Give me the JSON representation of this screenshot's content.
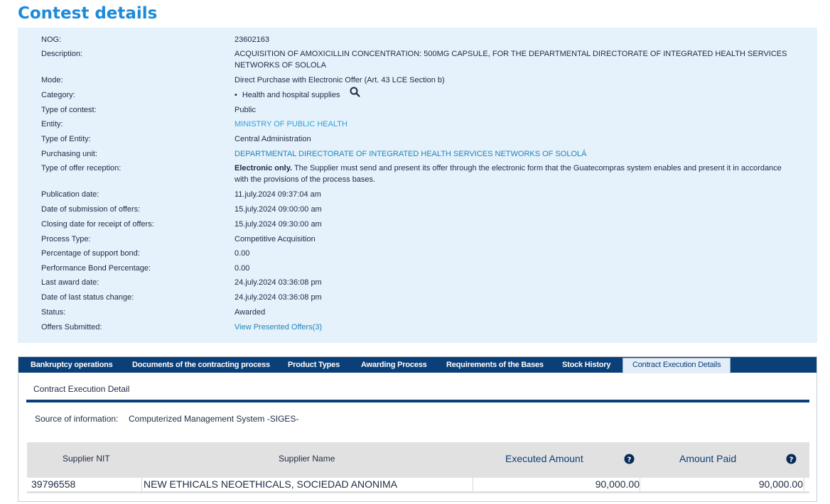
{
  "page": {
    "title": "Contest details"
  },
  "details": {
    "nog": {
      "label": "NOG:",
      "value": "23602163"
    },
    "description": {
      "label": "Description:",
      "value": "ACQUISITION OF AMOXICILLIN CONCENTRATION: 500MG CAPSULE, FOR THE DEPARTMENTAL DIRECTORATE OF INTEGRATED HEALTH SERVICES NETWORKS OF SOLOLA"
    },
    "mode": {
      "label": "Mode:",
      "value": "Direct Purchase with Electronic Offer (Art. 43 LCE Section b)"
    },
    "category": {
      "label": "Category:",
      "bullet": "•",
      "value": "Health and hospital supplies",
      "icon": "search-icon"
    },
    "type_of_contest": {
      "label": "Type of contest:",
      "value": "Public"
    },
    "entity": {
      "label": "Entity:",
      "value": "MINISTRY OF PUBLIC HEALTH"
    },
    "type_of_entity": {
      "label": "Type of Entity:",
      "value": "Central Administration"
    },
    "purchasing_unit": {
      "label": "Purchasing unit:",
      "value": "DEPARTMENTAL DIRECTORATE OF INTEGRATED HEALTH SERVICES NETWORKS OF SOLOLÁ"
    },
    "offer_reception": {
      "label": "Type of offer reception:",
      "value_bold": "Electronic only.",
      "value": " The Supplier must send and present its offer through the electronic form that the Guatecompras system enables and present it in accordance with the provisions of the process bases."
    },
    "publication_date": {
      "label": "Publication date:",
      "value": "11.july.2024 09:37:04 am"
    },
    "submission_date": {
      "label": "Date of submission of offers:",
      "value": "15.july.2024 09:00:00 am"
    },
    "closing_date": {
      "label": "Closing date for receipt of offers:",
      "value": "15.july.2024 09:30:00 am"
    },
    "process_type": {
      "label": "Process Type:",
      "value": "Competitive Acquisition"
    },
    "support_bond": {
      "label": "Percentage of support bond:",
      "value": "0.00"
    },
    "performance_bond": {
      "label": "Performance Bond Percentage:",
      "value": "0.00"
    },
    "last_award_date": {
      "label": "Last award date:",
      "value": "24.july.2024 03:36:08 pm"
    },
    "last_status_change": {
      "label": "Date of last status change:",
      "value": "24.july.2024 03:36:08 pm"
    },
    "status": {
      "label": "Status:",
      "value": "Awarded"
    },
    "offers_submitted": {
      "label": "Offers Submitted:",
      "value": "View Presented Offers(3)"
    }
  },
  "tabs": [
    {
      "label": "Bankruptcy operations"
    },
    {
      "label": "Documents of the contracting process"
    },
    {
      "label": "Product Types"
    },
    {
      "label": "Awarding Process"
    },
    {
      "label": "Requirements of the Bases"
    },
    {
      "label": "Stock History"
    },
    {
      "label": "Contract Execution Details",
      "active": true
    }
  ],
  "execution": {
    "section_title": "Contract Execution Detail",
    "source_label": "Source of information:",
    "source_value": "Computerized Management System -SIGES-",
    "columns": {
      "supplier_nit": "Supplier NIT",
      "supplier_name": "Supplier Name",
      "executed_amount": "Executed Amount",
      "amount_paid": "Amount Paid",
      "help_icon": "question-circle-icon"
    },
    "rows": [
      {
        "supplier_nit": "39796558",
        "supplier_name": "NEW ETHICALS NEOETHICALS, SOCIEDAD ANONIMA",
        "executed_amount": "90,000.00",
        "amount_paid": "90,000.00"
      }
    ]
  },
  "colors": {
    "title": "#1d8ad8",
    "panel_bg": "#e5f1fb",
    "tab_bar": "#0b3f78",
    "link": "#2ea3d8"
  }
}
